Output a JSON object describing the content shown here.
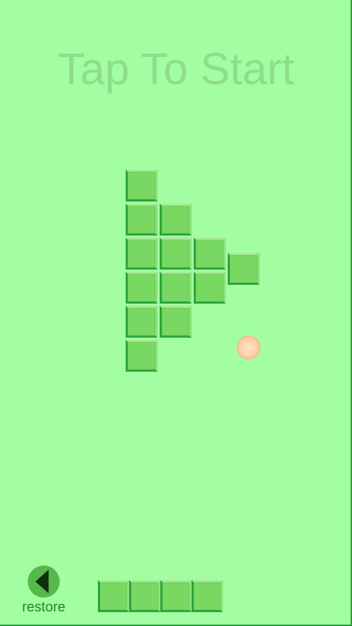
{
  "title": "Tap To Start",
  "restore": {
    "label": "restore",
    "icon": "left-triangle-icon"
  },
  "board": {
    "columns": [
      6,
      4,
      2,
      1
    ],
    "block_color": "#78d862",
    "background": "#a3fda1"
  },
  "tray": {
    "block_count": 4
  },
  "ball": {
    "icon": "ball",
    "color": "#ffcfa8"
  }
}
